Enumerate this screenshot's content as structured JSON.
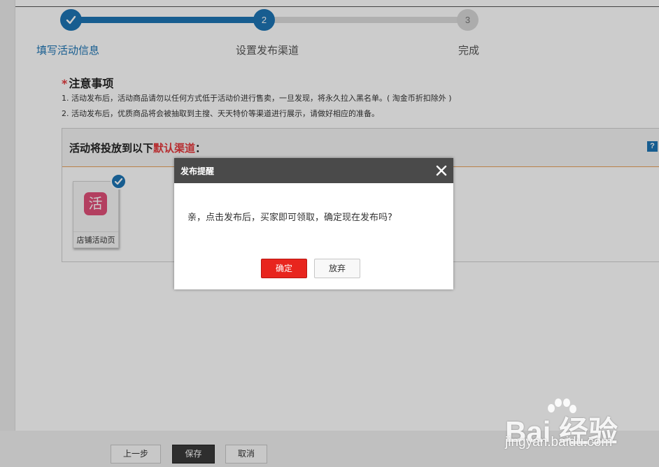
{
  "steps": [
    {
      "number": "1",
      "label": "填写活动信息",
      "status": "done"
    },
    {
      "number": "2",
      "label": "设置发布渠道",
      "status": "current"
    },
    {
      "number": "3",
      "label": "完成",
      "status": "todo"
    }
  ],
  "notice": {
    "star": "*",
    "title": "注意事项",
    "lines": [
      "1. 活动发布后，活动商品请勿以任何方式低于活动价进行售卖，一旦发现，将永久拉入黑名单。( 淘金币折扣除外 )",
      "2. 活动发布后，优质商品将会被抽取到主搜、天天特价等渠道进行展示，请做好相应的准备。"
    ]
  },
  "channels": {
    "title_prefix": "活动将投放到以下",
    "title_highlight": "默认渠道",
    "title_suffix": "：",
    "help": "?",
    "items": [
      {
        "icon_char": "活",
        "label": "店铺活动页",
        "checked": true
      }
    ]
  },
  "footer": {
    "prev": "上一步",
    "save": "保存",
    "cancel": "取消"
  },
  "modal": {
    "title": "发布提醒",
    "message": "亲，点击发布后，买家即可领取，确定现在发布吗?",
    "confirm": "确定",
    "cancel": "放弃"
  },
  "watermark": {
    "brand": "Bai 经验",
    "url": "jingyan.baidu.com"
  },
  "colors": {
    "primary": "#1d75b4",
    "danger": "#e8251e",
    "channel_icon": "#e04f78"
  }
}
